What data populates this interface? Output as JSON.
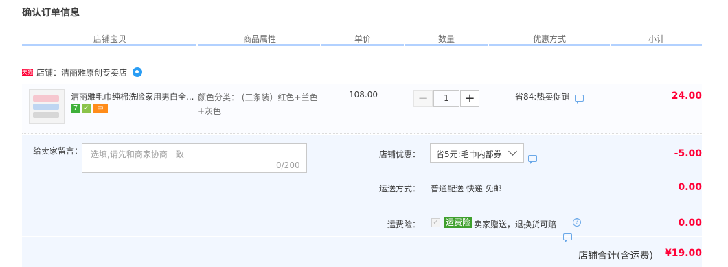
{
  "page_title": "确认订单信息",
  "table_headers": [
    "店铺宝贝",
    "商品属性",
    "单价",
    "数量",
    "优惠方式",
    "小计"
  ],
  "shop": {
    "badge": "天猫",
    "name": "店铺：洁丽雅原创专卖店"
  },
  "item": {
    "title": "洁丽雅毛巾纯棉洗脸家用男白全...",
    "attr_line1": "颜色分类：  (三条装）红色+兰色",
    "attr_line2": "+灰色",
    "price": "108.00",
    "quantity": "1",
    "minus": "−",
    "plus": "+",
    "promo": "省84:热卖促销",
    "subtotal": "24.00",
    "badge_7": "7"
  },
  "message": {
    "label": "给卖家留言：",
    "placeholder": "选填,请先和商家协商一致",
    "count": "0/200"
  },
  "shop_discount": {
    "label": "店铺优惠：",
    "selected": "省5元:毛巾内部券",
    "amount": "-5.00"
  },
  "shipping": {
    "label": "运送方式：",
    "value": "普通配送 快递 免邮",
    "amount": "0.00"
  },
  "insurance": {
    "label": "运费险：",
    "tag": "运费险",
    "desc": "卖家赠送，退换货可赔",
    "help": "?",
    "check": "✓",
    "amount": "0.00"
  },
  "total": {
    "label": "店铺合计(含运费)",
    "value": "¥19.00"
  },
  "colors": {
    "accent_red": "#ff0036",
    "header_line": "#b2d1ff",
    "panel_bg": "#f2f7ff",
    "insurance_green": "#3fa02e"
  },
  "icons": [
    "wangwang-chat-icon",
    "message-bubble-icon",
    "help-circle-icon",
    "chevron-down-icon",
    "checkbox-icon"
  ]
}
